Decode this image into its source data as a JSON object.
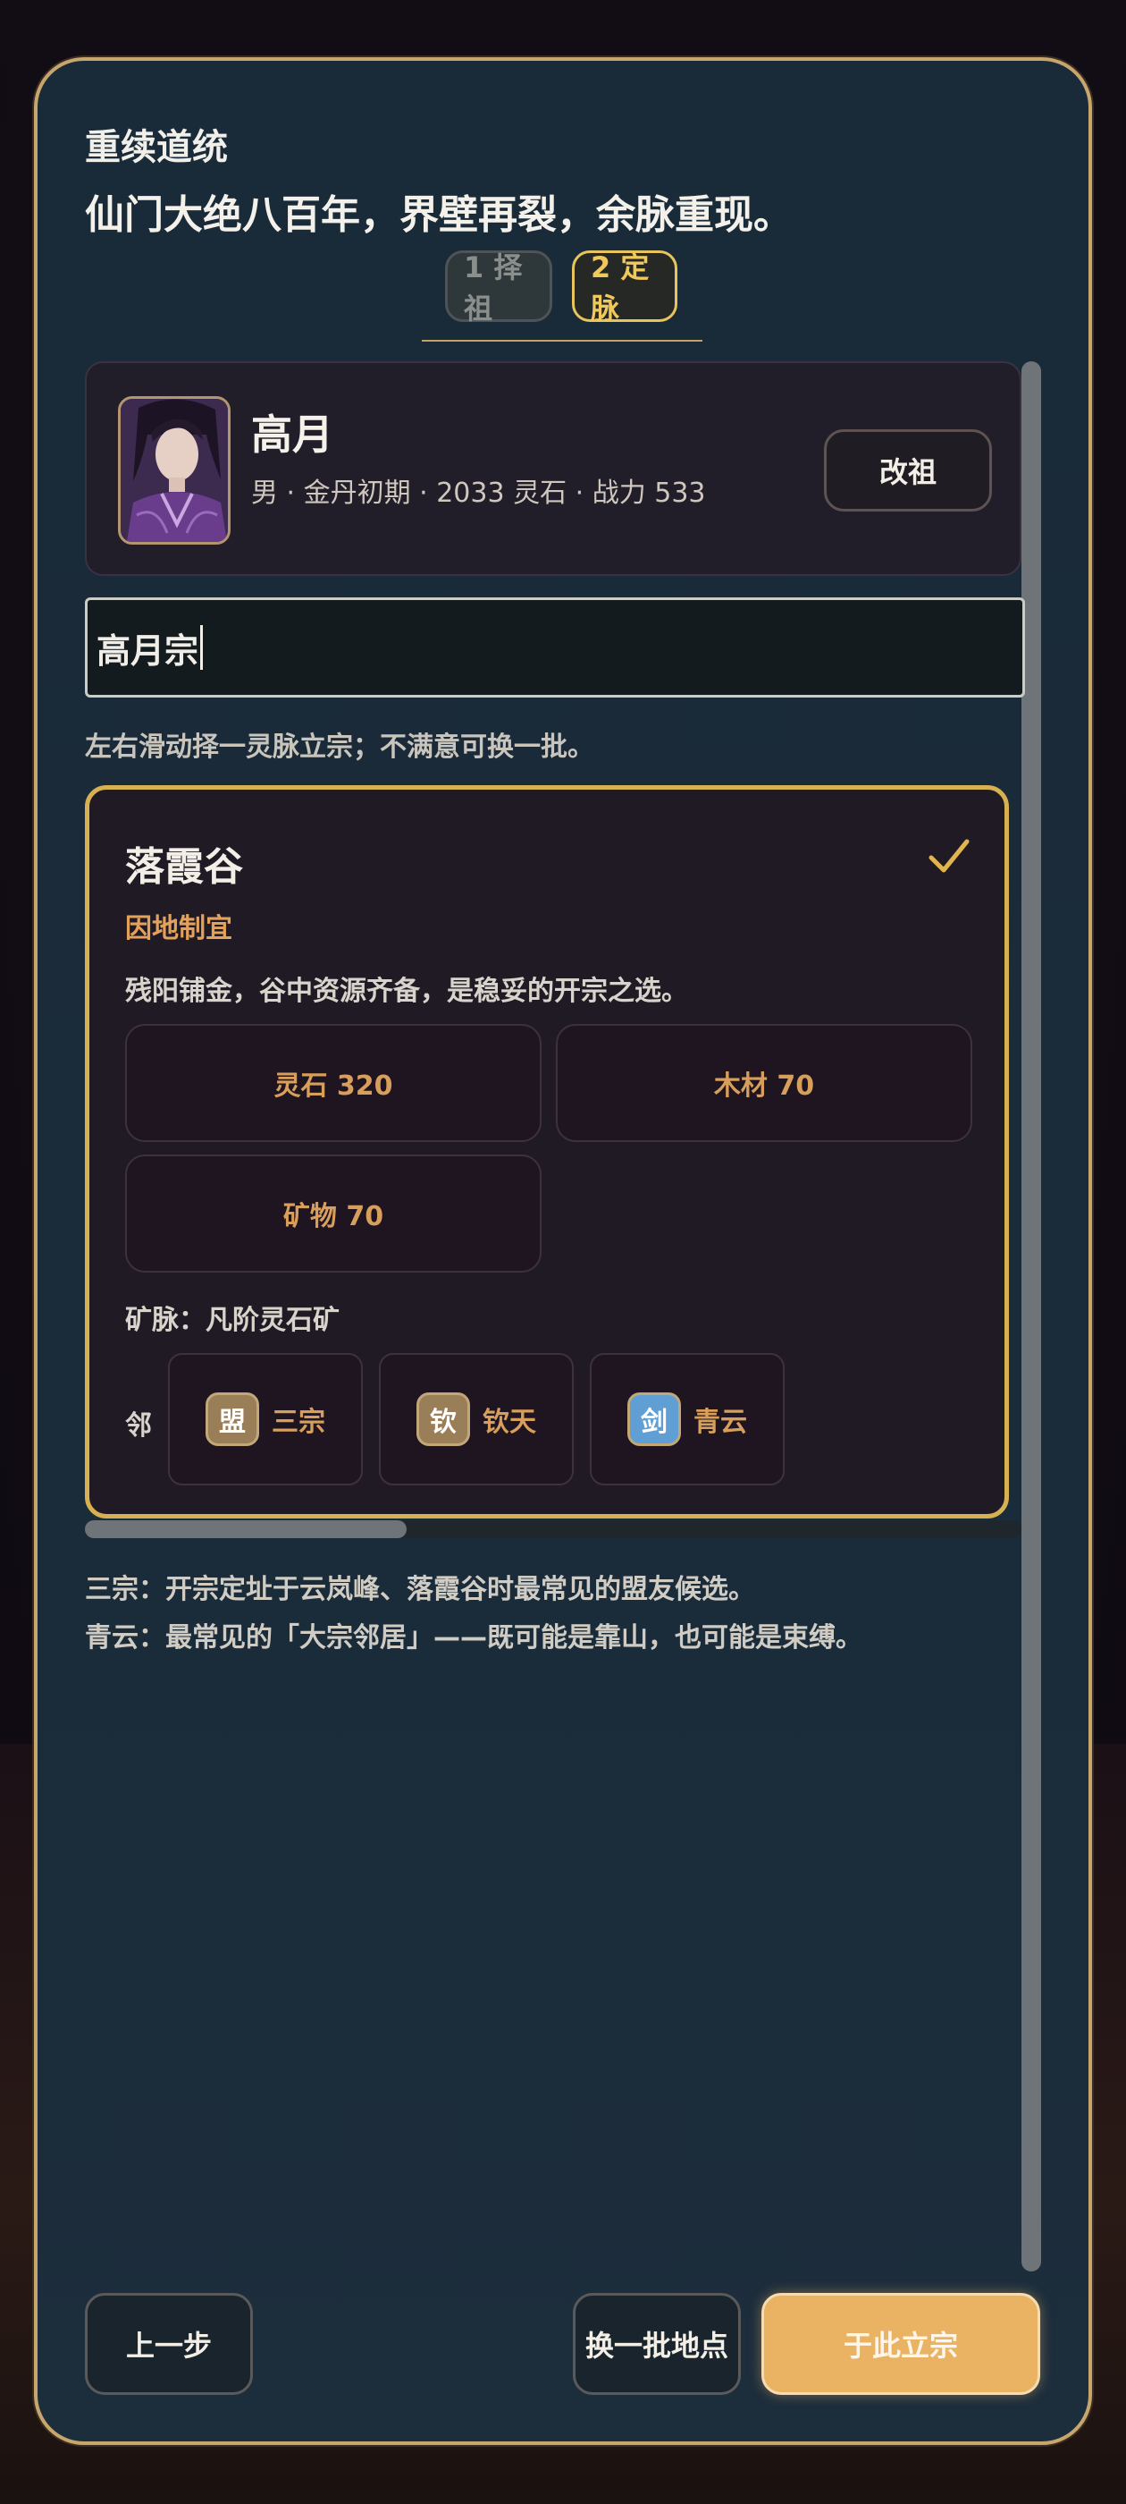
{
  "header": {
    "subtitle": "重续道统",
    "title": "仙门大绝八百年，界壁再裂，余脉重现。"
  },
  "steps": [
    {
      "label": "1 择祖",
      "state": "inactive"
    },
    {
      "label": "2 定脉",
      "state": "active"
    }
  ],
  "founder": {
    "name": "高月",
    "info": "男 · 金丹初期 · 2033 灵石 · 战力 533",
    "change_button": "改祖",
    "avatar_icon": "portrait-icon"
  },
  "sect_name_input": {
    "value": "高月宗"
  },
  "hint": "左右滑动择一灵脉立宗；不满意可换一批。",
  "site": {
    "name": "落霞谷",
    "selected": true,
    "tag": "因地制宜",
    "description": "残阳铺金，谷中资源齐备，是稳妥的开宗之选。",
    "resources": [
      "灵石 320",
      "木材 70",
      "矿物 70"
    ],
    "mine": "矿脉：凡阶灵石矿",
    "neighbor_label": "邻",
    "neighbors": [
      {
        "badge": "盟",
        "name": "三宗",
        "color": "#9a7e58"
      },
      {
        "badge": "钦",
        "name": "钦天",
        "color": "#9a7e58"
      },
      {
        "badge": "剑",
        "name": "青云",
        "color": "#5f9fd3"
      }
    ]
  },
  "notes": [
    "三宗：开宗定址于云岚峰、落霞谷时最常见的盟友候选。",
    "青云：最常见的「大宗邻居」——既可能是靠山，也可能是束缚。"
  ],
  "footer": {
    "back_label": "上一步",
    "refresh_label": "换一批地点",
    "confirm_label": "于此立宗"
  },
  "colors": {
    "accent_gold": "#d6b051",
    "primary_button": "#e9b363",
    "panel_bg": "#192a38"
  }
}
